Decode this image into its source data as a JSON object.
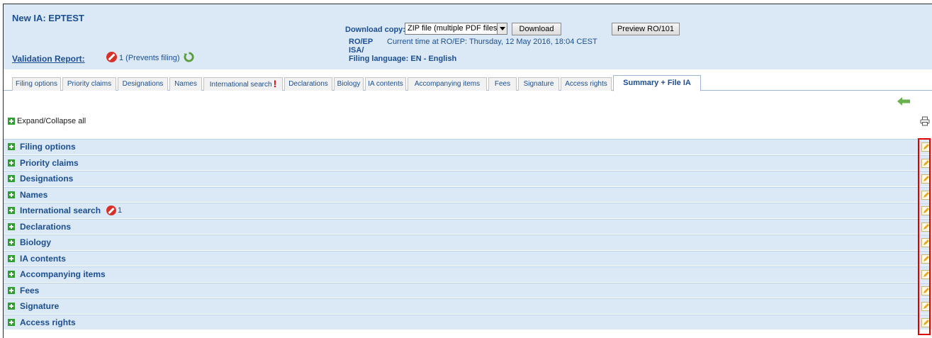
{
  "header": {
    "title": "New IA: EPTEST",
    "validation_label": "Validation Report:",
    "validation_text": "1 (Prevents filing)",
    "download_label": "Download copy:",
    "download_select_value": "ZIP file (multiple PDF files)",
    "download_button": "Download",
    "preview_button": "Preview RO/101",
    "ro_label": "RO/EP",
    "ro_time": "Current time at RO/EP:  Thursday, 12 May 2016, 18:04 CEST",
    "isa_label": "ISA/",
    "filing_language": "Filing language: EN - English"
  },
  "tabs": [
    {
      "label": "Filing options"
    },
    {
      "label": "Priority claims"
    },
    {
      "label": "Designations"
    },
    {
      "label": "Names"
    },
    {
      "label": "International search",
      "error": "!"
    },
    {
      "label": "Declarations"
    },
    {
      "label": "Biology"
    },
    {
      "label": "IA contents"
    },
    {
      "label": "Accompanying items"
    },
    {
      "label": "Fees"
    },
    {
      "label": "Signature"
    },
    {
      "label": "Access rights"
    },
    {
      "label": "Summary + File IA",
      "active": true
    }
  ],
  "toolbar": {
    "expand_collapse": "Expand/Collapse all",
    "back_icon": "back-arrow-icon",
    "print_icon": "print-icon"
  },
  "sections": [
    {
      "label": "Filing options"
    },
    {
      "label": "Priority claims"
    },
    {
      "label": "Designations"
    },
    {
      "label": "Names"
    },
    {
      "label": "International search",
      "error_count": "1"
    },
    {
      "label": "Declarations"
    },
    {
      "label": "Biology"
    },
    {
      "label": "IA contents"
    },
    {
      "label": "Accompanying items"
    },
    {
      "label": "Fees"
    },
    {
      "label": "Signature"
    },
    {
      "label": "Access rights"
    }
  ],
  "colors": {
    "header_bg": "#dbe9f7",
    "link_text": "#1b4e92",
    "error": "#d9302a",
    "highlight": "#e00000"
  }
}
